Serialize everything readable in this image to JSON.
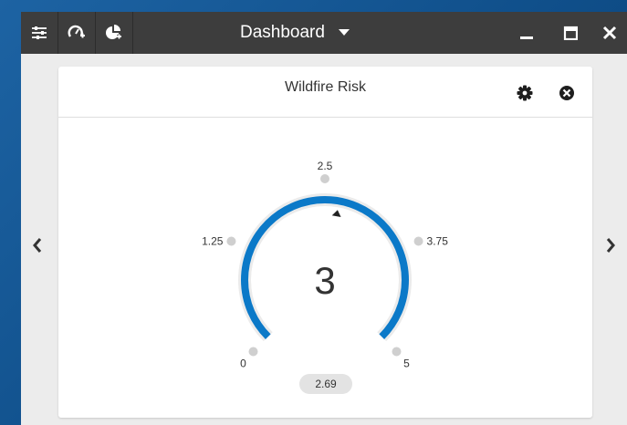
{
  "titlebar": {
    "title": "Dashboard",
    "icons": [
      "sliders-icon",
      "gauge-add-icon",
      "pie-add-icon"
    ],
    "controls": [
      "minimize-icon",
      "maximize-icon",
      "close-icon"
    ]
  },
  "card": {
    "title": "Wildfire Risk",
    "icons": [
      "gear-icon",
      "close-circle-icon"
    ]
  },
  "gauge": {
    "min": 0,
    "max": 5,
    "value": 3,
    "value_label": "3",
    "secondary_value": "2.69",
    "secondary_value_numeric": 2.69,
    "ticks": [
      "0",
      "1.25",
      "2.5",
      "3.75",
      "5"
    ],
    "tick_values": [
      0,
      1.25,
      2.5,
      3.75,
      5
    ],
    "colors": {
      "fill": "#0b79c8",
      "track": "#ebebeb",
      "tick_dot": "#cfcfcf",
      "marker": "#222222"
    }
  },
  "nav": {
    "prev_icon": "chevron-left-icon",
    "next_icon": "chevron-right-icon"
  }
}
